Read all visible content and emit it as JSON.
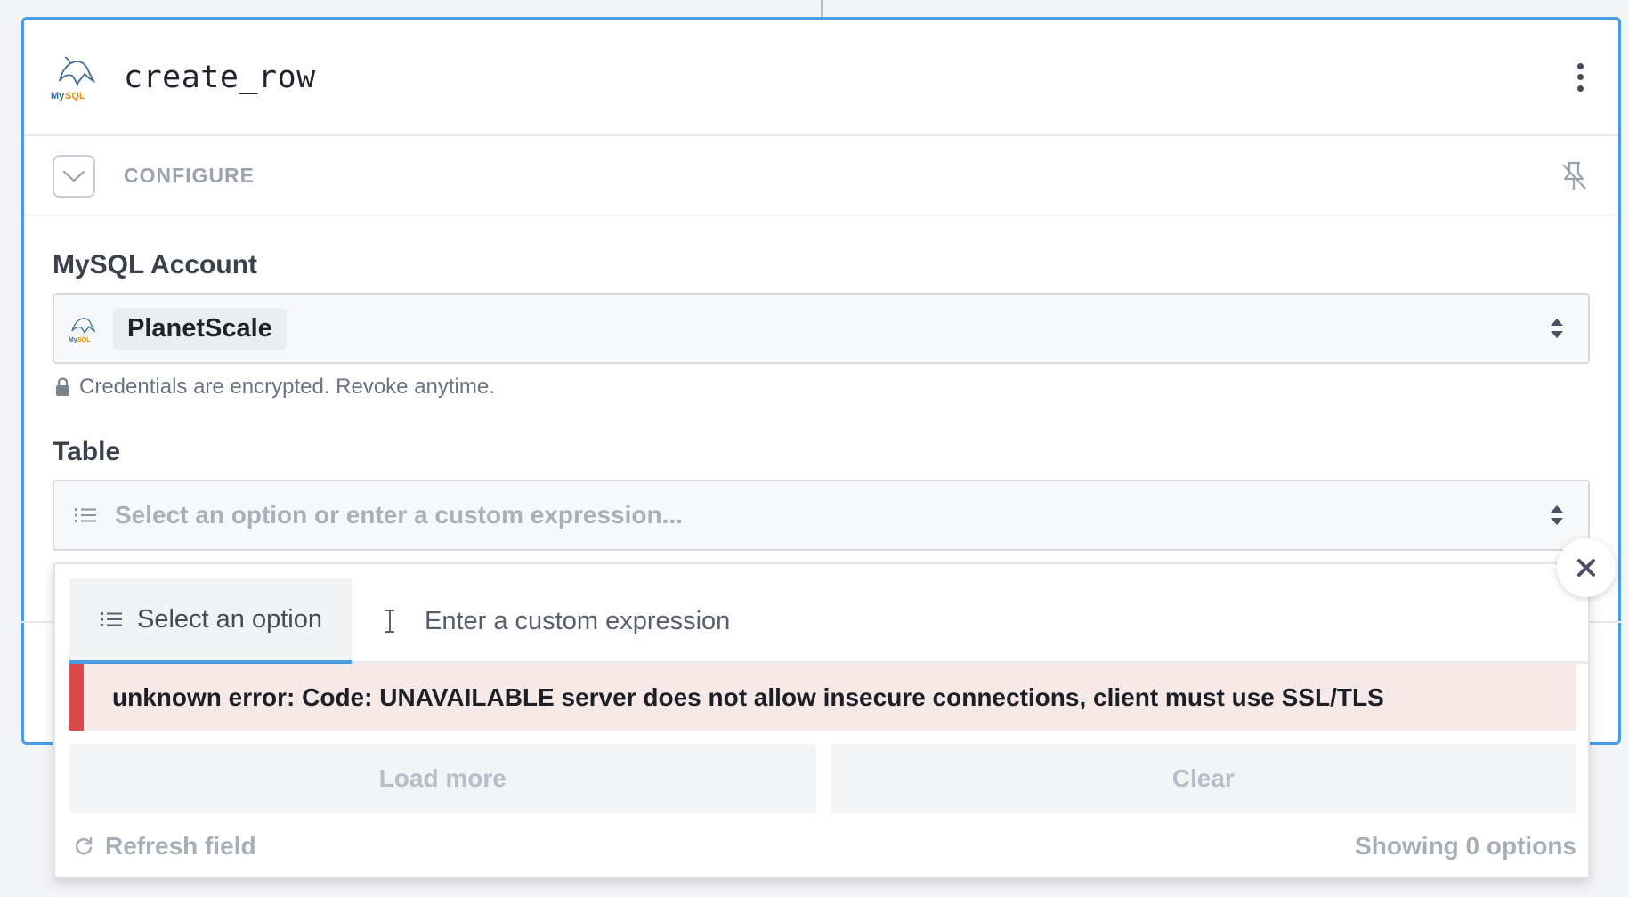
{
  "step": {
    "title": "create_row",
    "app_icon": "mysql-dolphin-icon",
    "menu_icon": "kebab-menu-icon"
  },
  "section": {
    "label": "CONFIGURE",
    "toggle_icon": "chevron-down-icon",
    "pin_icon": "unpin-icon"
  },
  "account_field": {
    "label": "MySQL Account",
    "selected_value": "PlanetScale",
    "hint": "Credentials are encrypted. Revoke anytime."
  },
  "table_field": {
    "label": "Table",
    "placeholder": "Select an option or enter a custom expression..."
  },
  "dropdown": {
    "tabs": [
      {
        "label": "Select an option",
        "active": true
      },
      {
        "label": "Enter a custom expression",
        "active": false
      }
    ],
    "error_message": "unknown error: Code: UNAVAILABLE server does not allow insecure connections, client must use SSL/TLS",
    "load_more_label": "Load more",
    "clear_label": "Clear",
    "refresh_label": "Refresh field",
    "showing_label": "Showing 0 options"
  },
  "colors": {
    "accent": "#4a9ce8",
    "error": "#db4a4a",
    "error_bg": "#f8e9e9"
  }
}
